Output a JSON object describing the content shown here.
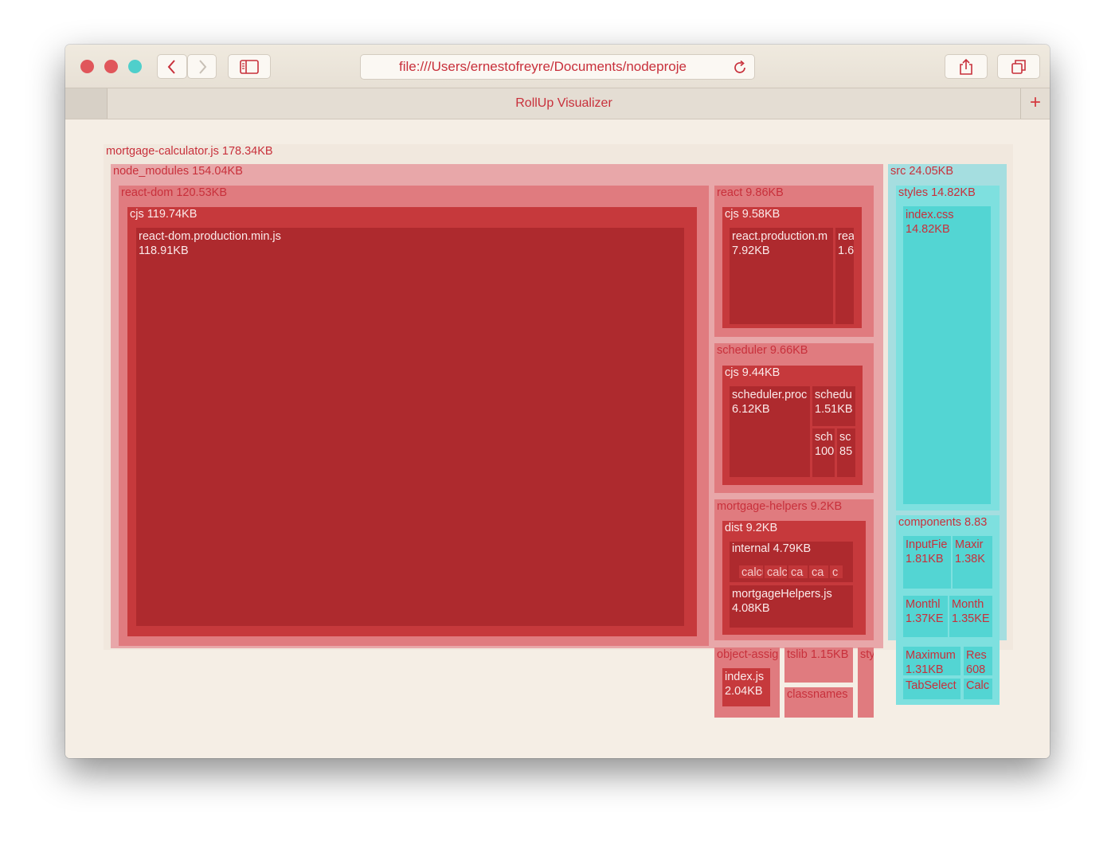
{
  "window": {
    "url": "file:///Users/ernestofreyre/Documents/nodeproje",
    "tab_title": "RollUp Visualizer",
    "new_tab_glyph": "+"
  },
  "toolbar": {
    "back_icon": "chevron-left-icon",
    "forward_icon": "chevron-right-icon",
    "sidebar_icon": "sidebar-icon",
    "reload_icon": "reload-icon",
    "share_icon": "share-icon",
    "tabs_icon": "tabs-overview-icon"
  },
  "colors": {
    "close": "#e0565b",
    "minimize": "#e0565b",
    "zoom": "#4fcfcb",
    "accent": "#c8303b",
    "background": "#f5eee5",
    "red_light": "#e8a7a9",
    "red_mid": "#e07b7f",
    "red_dark": "#ae2a2e",
    "teal_light": "#a5dee0",
    "teal": "#53d5d3"
  },
  "treemap": {
    "name": "mortgage-calculator.js",
    "size": "178.34KB",
    "children": [
      {
        "name": "node_modules",
        "size": "154.04KB",
        "children": [
          {
            "name": "react-dom",
            "size": "120.53KB",
            "children": [
              {
                "name": "cjs",
                "size": "119.74KB",
                "children": [
                  {
                    "name": "react-dom.production.min.js",
                    "size": "118.91KB"
                  }
                ]
              }
            ]
          },
          {
            "name": "react",
            "size": "9.86KB",
            "children": [
              {
                "name": "cjs",
                "size": "9.58KB",
                "children": [
                  {
                    "name": "react.production.m",
                    "size": "7.92KB"
                  },
                  {
                    "name": "rea",
                    "size": "1.6"
                  }
                ]
              }
            ]
          },
          {
            "name": "scheduler",
            "size": "9.66KB",
            "children": [
              {
                "name": "cjs",
                "size": "9.44KB",
                "children": [
                  {
                    "name": "scheduler.proc",
                    "size": "6.12KB"
                  },
                  {
                    "name": "schedu",
                    "size": "1.51KB"
                  },
                  {
                    "name": "sch",
                    "size": "100"
                  },
                  {
                    "name": "sc",
                    "size": "85"
                  }
                ]
              }
            ]
          },
          {
            "name": "mortgage-helpers",
            "size": "9.2KB",
            "children": [
              {
                "name": "dist",
                "size": "9.2KB",
                "children": [
                  {
                    "name": "internal",
                    "size": "4.79KB",
                    "children": [
                      {
                        "name": "calcu"
                      },
                      {
                        "name": "calc"
                      },
                      {
                        "name": "ca"
                      },
                      {
                        "name": "ca"
                      },
                      {
                        "name": "c"
                      }
                    ]
                  },
                  {
                    "name": "mortgageHelpers.js",
                    "size": "4.08KB"
                  }
                ]
              }
            ]
          },
          {
            "name": "object-assig",
            "children": [
              {
                "name": "index.js",
                "size": "2.04KB"
              }
            ]
          },
          {
            "name": "tslib",
            "size": "1.15KB"
          },
          {
            "name": "classnames"
          },
          {
            "name": "sty"
          }
        ]
      },
      {
        "name": "src",
        "size": "24.05KB",
        "children": [
          {
            "name": "styles",
            "size": "14.82KB",
            "children": [
              {
                "name": "index.css",
                "size": "14.82KB"
              }
            ]
          },
          {
            "name": "components",
            "size": "8.83",
            "children": [
              {
                "name": "InputFie",
                "size": "1.81KB"
              },
              {
                "name": "Maxir",
                "size": "1.38K"
              },
              {
                "name": "Monthl",
                "size": "1.37KE"
              },
              {
                "name": "Month",
                "size": "1.35KE"
              },
              {
                "name": "Maximum",
                "size": "1.31KB"
              },
              {
                "name": "Res",
                "size": "608"
              },
              {
                "name": "TabSelect"
              },
              {
                "name": "Calc"
              }
            ]
          }
        ]
      }
    ]
  }
}
